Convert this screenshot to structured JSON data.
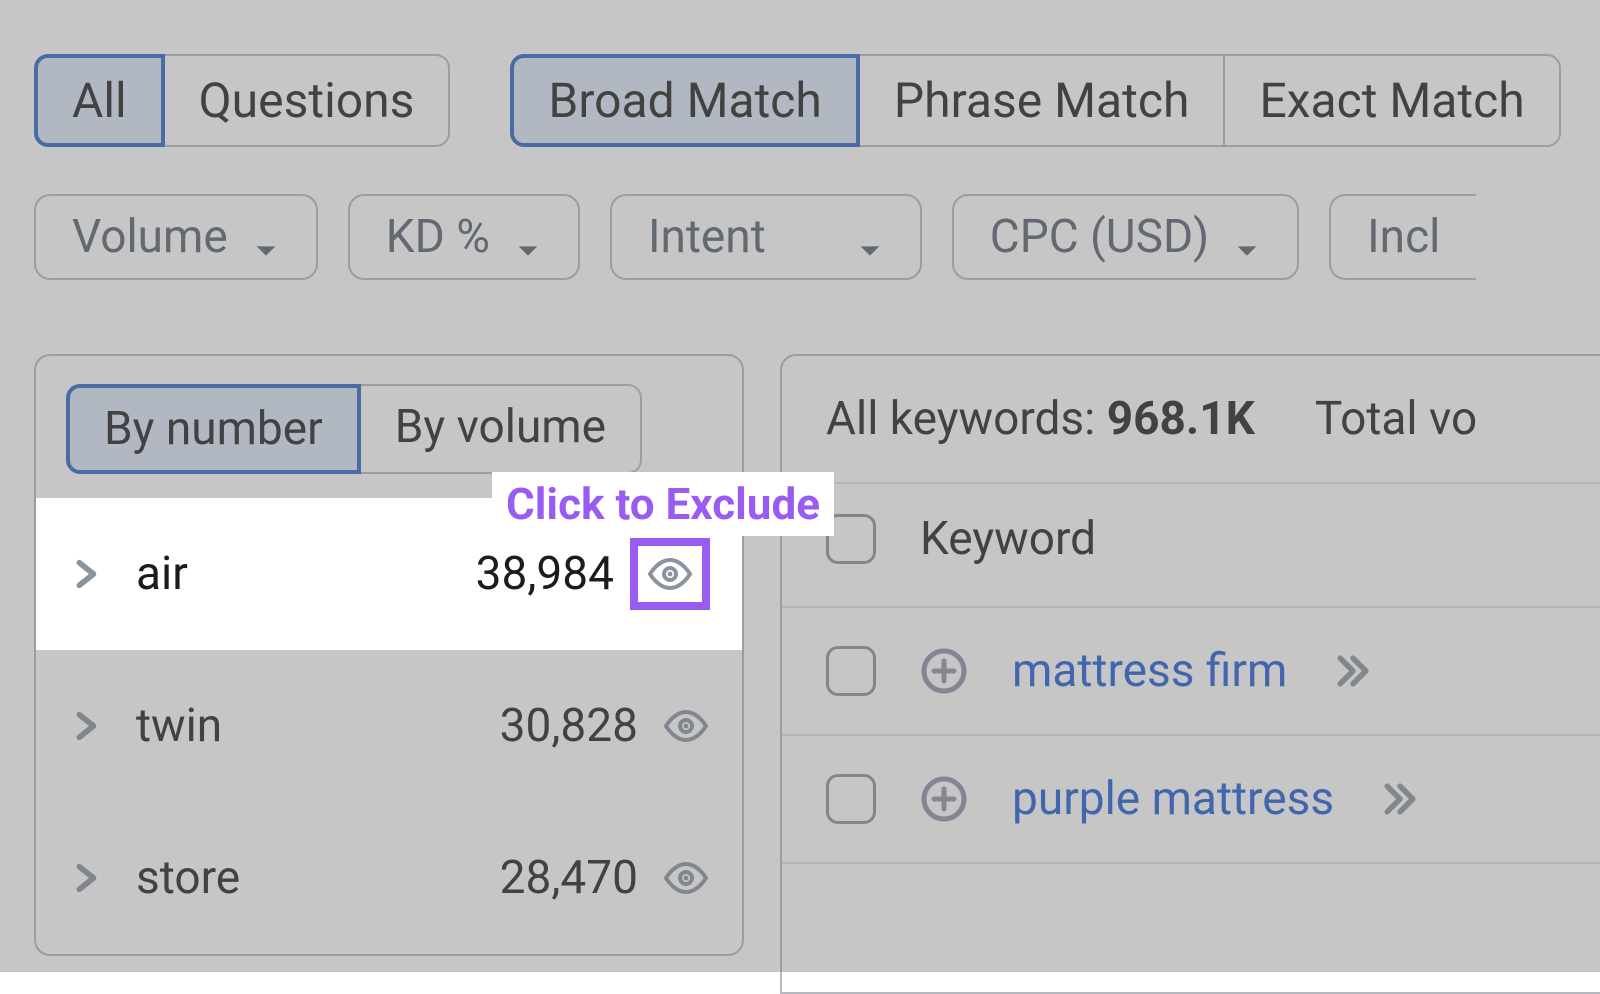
{
  "tabs1": {
    "all": "All",
    "questions": "Questions"
  },
  "tabs2": {
    "broad": "Broad Match",
    "phrase": "Phrase Match",
    "exact": "Exact Match"
  },
  "filters": {
    "volume": "Volume",
    "kd": "KD %",
    "intent": "Intent",
    "cpc": "CPC (USD)",
    "incl": "Incl"
  },
  "sort": {
    "by_number": "By number",
    "by_volume": "By volume"
  },
  "groups": [
    {
      "label": "air",
      "count": "38,984"
    },
    {
      "label": "twin",
      "count": "30,828"
    },
    {
      "label": "store",
      "count": "28,470"
    }
  ],
  "callout": "Click to Exclude",
  "summary": {
    "all_label": "All keywords:",
    "all_value": "968.1K",
    "total_label": "Total vo"
  },
  "table": {
    "header": "Keyword",
    "rows": [
      {
        "keyword": "mattress firm"
      },
      {
        "keyword": "purple mattress"
      }
    ]
  }
}
